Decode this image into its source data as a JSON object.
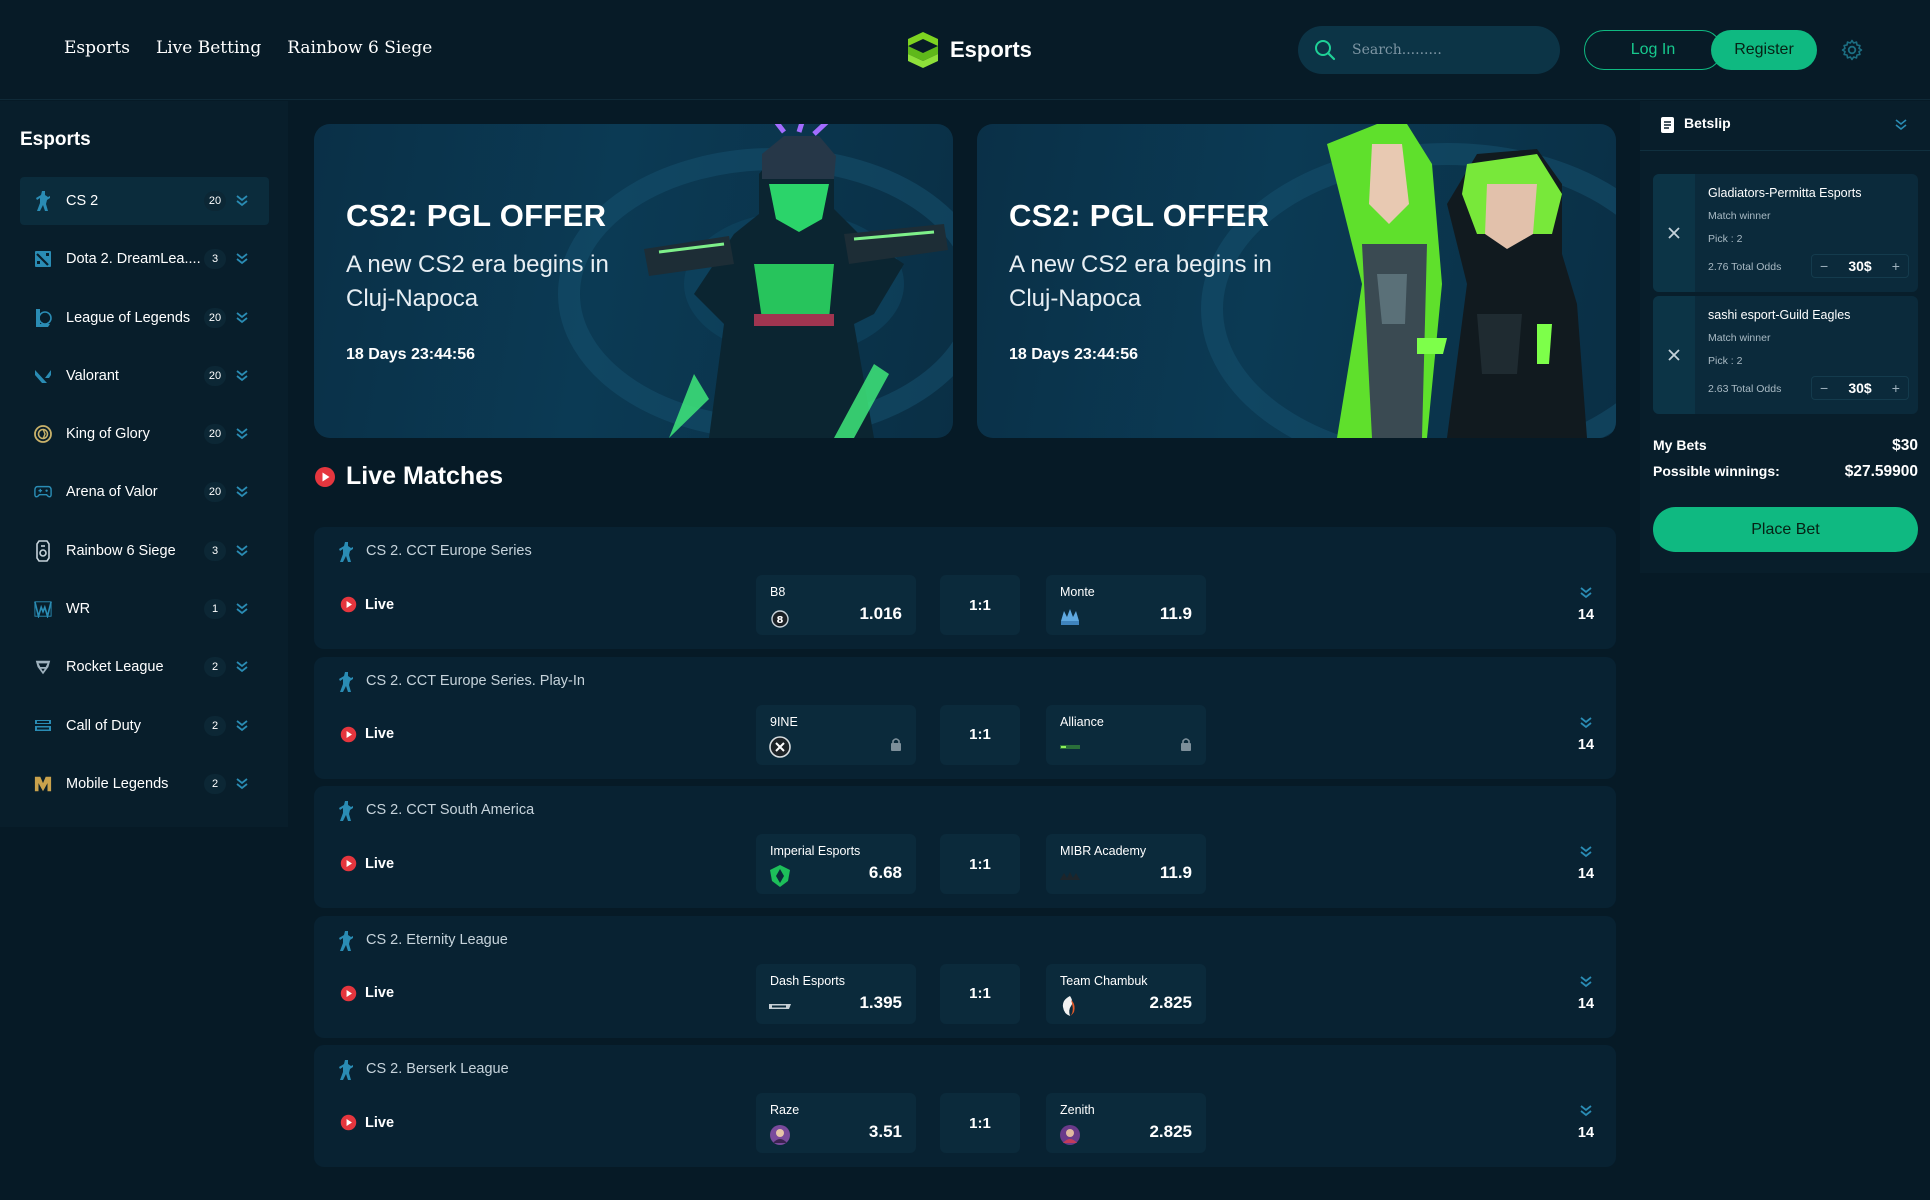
{
  "header": {
    "nav": [
      "Esports",
      "Live Betting",
      "Rainbow 6 Siege"
    ],
    "logo_text": "Esports",
    "search_placeholder": "Search.........",
    "login_label": "Log In",
    "register_label": "Register"
  },
  "sidebar": {
    "title": "Esports",
    "items": [
      {
        "label": "CS 2",
        "count": "20",
        "icon": "cs2-icon"
      },
      {
        "label": "Dota 2. DreamLea....",
        "count": "3",
        "icon": "dota2-icon"
      },
      {
        "label": "League of Legends",
        "count": "20",
        "icon": "lol-icon"
      },
      {
        "label": "Valorant",
        "count": "20",
        "icon": "valorant-icon"
      },
      {
        "label": "King of Glory",
        "count": "20",
        "icon": "king-of-glory-icon"
      },
      {
        "label": "Arena of Valor",
        "count": "20",
        "icon": "gamepad-icon"
      },
      {
        "label": "Rainbow 6 Siege",
        "count": "3",
        "icon": "r6-icon"
      },
      {
        "label": "WR",
        "count": "1",
        "icon": "wr-icon"
      },
      {
        "label": "Rocket League",
        "count": "2",
        "icon": "rocket-league-icon"
      },
      {
        "label": "Call of Duty",
        "count": "2",
        "icon": "call-of-duty-icon"
      },
      {
        "label": "Mobile Legends",
        "count": "2",
        "icon": "mobile-legends-icon"
      }
    ]
  },
  "banners": [
    {
      "title": "CS2: PGL OFFER",
      "subtitle": "A new CS2 era begins in Cluj-Napoca",
      "timer": "18 Days 23:44:56"
    },
    {
      "title": "CS2: PGL OFFER",
      "subtitle": "A new CS2 era begins in Cluj-Napoca",
      "timer": "18 Days 23:44:56"
    }
  ],
  "live": {
    "title": "Live Matches",
    "matches": [
      {
        "league": "CS 2. CCT Europe Series",
        "status": "Live",
        "team1": "B8",
        "odds1": "1.016",
        "score": "1:1",
        "team2": "Monte",
        "odds2": "11.9",
        "more": "14"
      },
      {
        "league": "CS 2. CCT Europe Series. Play-In",
        "status": "Live",
        "team1": "9INE",
        "odds1": "",
        "score": "1:1",
        "team2": "Alliance",
        "odds2": "",
        "more": "14"
      },
      {
        "league": "CS 2. CCT South America",
        "status": "Live",
        "team1": "Imperial Esports",
        "odds1": "6.68",
        "score": "1:1",
        "team2": "MIBR Academy",
        "odds2": "11.9",
        "more": "14"
      },
      {
        "league": "CS 2. Eternity League",
        "status": "Live",
        "team1": "Dash Esports",
        "odds1": "1.395",
        "score": "1:1",
        "team2": "Team Chambuk",
        "odds2": "2.825",
        "more": "14"
      },
      {
        "league": "CS 2. Berserk League",
        "status": "Live",
        "team1": "Raze",
        "odds1": "3.51",
        "score": "1:1",
        "team2": "Zenith",
        "odds2": "2.825",
        "more": "14"
      }
    ]
  },
  "betslip": {
    "title": "Betslip",
    "bets": [
      {
        "name": "Gladiators-Permitta Esports",
        "market": "Match winner",
        "pick": "Pick : 2",
        "odds": "2.76 Total Odds",
        "stake": "30$"
      },
      {
        "name": "sashi esport-Guild Eagles",
        "market": "Match winner",
        "pick": "Pick : 2",
        "odds": "2.63 Total Odds",
        "stake": "30$"
      }
    ],
    "my_bets_label": "My Bets",
    "my_bets_value": "$30",
    "winnings_label": "Possible winnings:",
    "winnings_value": "$27.59900",
    "place_bet_label": "Place Bet"
  },
  "colors": {
    "accent": "#0fb981",
    "background": "#061a26",
    "panel": "#081e2b",
    "card": "#0b2a3b",
    "live_red": "#e5363e"
  }
}
